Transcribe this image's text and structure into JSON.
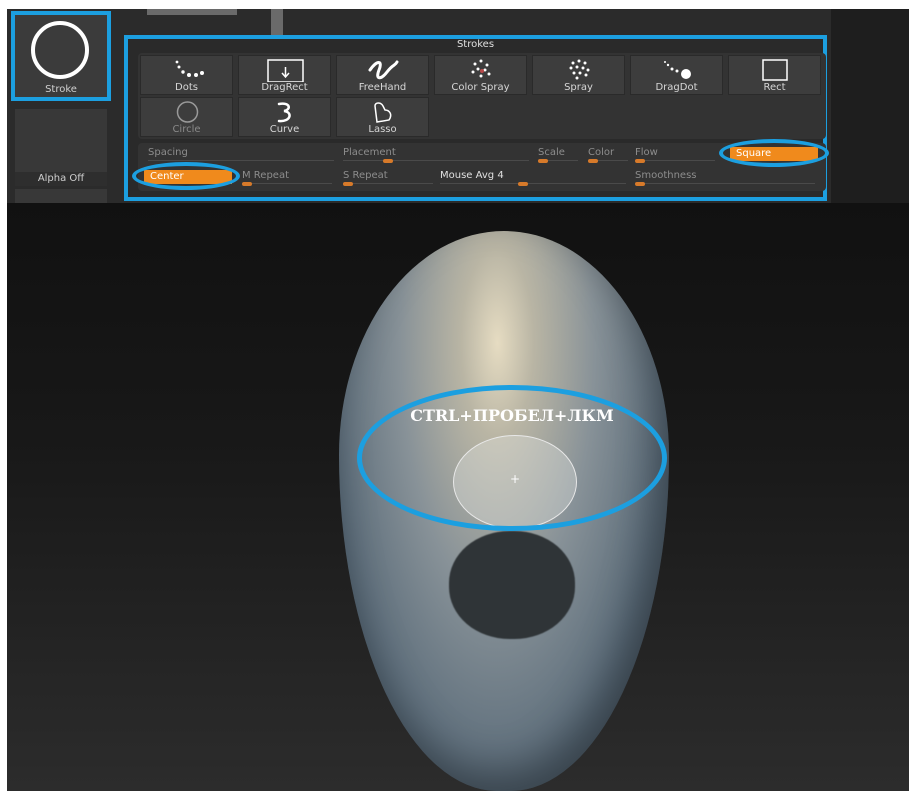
{
  "left_panel": {
    "stroke_label": "Stroke",
    "alpha_label": "Alpha Off"
  },
  "strokes": {
    "title": "Strokes",
    "buttons": [
      {
        "label": "Dots",
        "icon": "dots-icon"
      },
      {
        "label": "DragRect",
        "icon": "drag-rect-icon"
      },
      {
        "label": "FreeHand",
        "icon": "freehand-icon"
      },
      {
        "label": "Color Spray",
        "icon": "color-spray-icon"
      },
      {
        "label": "Spray",
        "icon": "spray-icon"
      },
      {
        "label": "DragDot",
        "icon": "drag-dot-icon"
      },
      {
        "label": "Rect",
        "icon": "rect-icon"
      },
      {
        "label": "Circle",
        "icon": "circle-icon"
      },
      {
        "label": "Curve",
        "icon": "curve-icon"
      },
      {
        "label": "Lasso",
        "icon": "lasso-icon"
      }
    ]
  },
  "settings": {
    "spacing": "Spacing",
    "placement": "Placement",
    "scale": "Scale",
    "color": "Color",
    "flow": "Flow",
    "square": "Square",
    "center": "Center",
    "m_repeat": "M Repeat",
    "s_repeat": "S Repeat",
    "mouse_avg": "Mouse Avg 4",
    "smoothness": "Smoothness"
  },
  "viewport": {
    "hint": "CTRL+ПРОБЕЛ+ЛКМ",
    "cursor": "+"
  },
  "colors": {
    "highlight": "#1c9fe0",
    "accent_orange": "#f08a1c"
  }
}
